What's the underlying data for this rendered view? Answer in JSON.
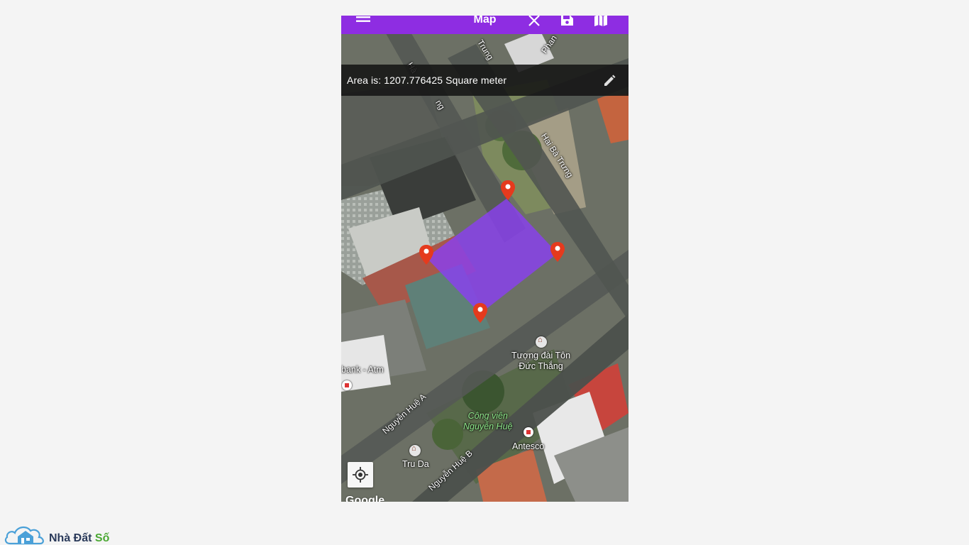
{
  "app": {
    "title": "Map",
    "toolbar_icons": [
      "menu-icon",
      "close-icon",
      "save-icon",
      "map-icon"
    ]
  },
  "area_bar": {
    "label": "Area is:",
    "value": "1207.776425",
    "unit": "Square meter",
    "edit_icon": "pencil-icon"
  },
  "map": {
    "street_labels": [
      "Hai Bà Trưng",
      "Nguyễn Huệ A",
      "Nguyễn Huệ B",
      "Hai Bà Trưng (top)",
      "Phan"
    ],
    "street_text": {
      "hai_ba_trung": "Hai Bà Trưng",
      "nguyen_hue_a": "Nguyễn Huệ A",
      "nguyen_hue_b": "Nguyễn Huệ B",
      "top_trung": "Trung",
      "top_phan": "Phan",
      "top_hang": "Hà",
      "top_ng": "ng"
    },
    "places": {
      "monument": "Tượng đài Tôn Đức Thắng",
      "monument_line1": "Tượng đài Tôn",
      "monument_line2": "Đức Thắng",
      "park_line1": "Công viên",
      "park_line2": "Nguyễn Huệ",
      "antesco": "Antesco",
      "tru_da": "Tru Da",
      "bank": "bank - Atm"
    },
    "polygon_color": "#8a3ff0",
    "marker_color": "#e53a1d",
    "marker_count": 4
  },
  "locate_button": {
    "icon": "my-location-icon"
  },
  "attribution": "Google",
  "brand": {
    "name_part1": "Nhà Đất",
    "name_part2": "Số",
    "icon": "house-cloud-icon"
  }
}
